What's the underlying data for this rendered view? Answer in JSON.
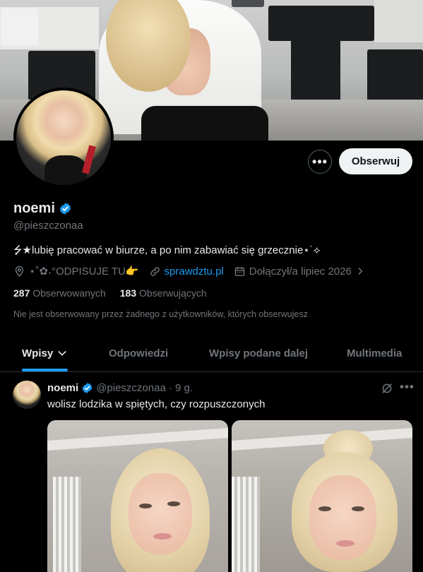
{
  "profile": {
    "name": "noemi",
    "handle": "@pieszczonaa",
    "bio": "⭍★lubię pracować w biurze, a po nim zabawiać się grzecznie⋆˙⟡",
    "location": "⋆˚✿˖°ODPISUJE TU👉",
    "website": "sprawdztu.pl",
    "joined": "Dołączył/a lipiec 2026",
    "following_count": "287",
    "following_label": "Obserwowanych",
    "followers_count": "183",
    "followers_label": "Obserwujących",
    "followers_note": "Nie jest obserwowany przez żadnego z użytkowników, których obserwujesz"
  },
  "actions": {
    "more": "•••",
    "follow": "Obserwuj"
  },
  "tabs": [
    {
      "label": "Wpisy",
      "active": true
    },
    {
      "label": "Odpowiedzi",
      "active": false
    },
    {
      "label": "Wpisy podane dalej",
      "active": false
    },
    {
      "label": "Multimedia",
      "active": false
    }
  ],
  "post": {
    "name": "noemi",
    "handle": "@pieszczonaa",
    "time": "· 9 g.",
    "text": "wolisz lodzika w spiętych, czy rozpuszczonych",
    "more": "•••"
  },
  "colors": {
    "background": "#000000",
    "accent": "#1d9bf0",
    "text": "#e7e9ea",
    "muted": "#71767b",
    "follow_button": "#eff3f4"
  }
}
